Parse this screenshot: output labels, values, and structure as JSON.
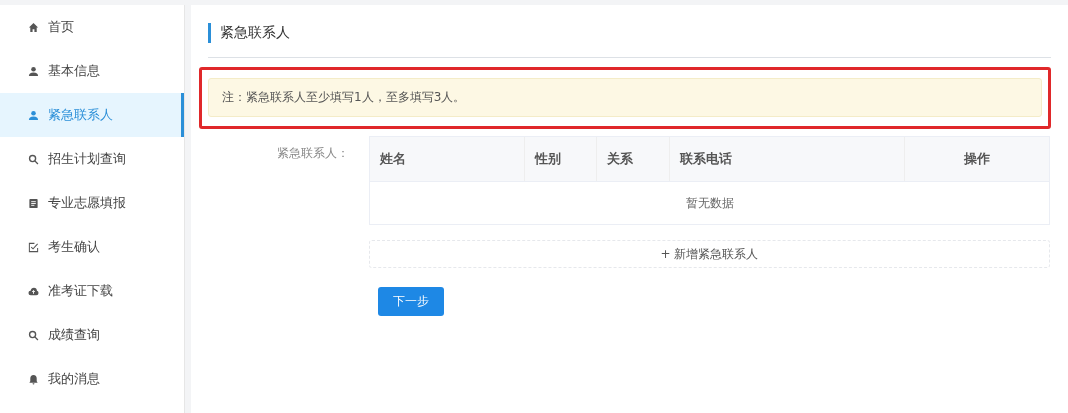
{
  "sidebar": {
    "items": [
      {
        "label": "首页",
        "selected": false
      },
      {
        "label": "基本信息",
        "selected": false
      },
      {
        "label": "紧急联系人",
        "selected": true
      },
      {
        "label": "招生计划查询",
        "selected": false
      },
      {
        "label": "专业志愿填报",
        "selected": false
      },
      {
        "label": "考生确认",
        "selected": false
      },
      {
        "label": "准考证下载",
        "selected": false
      },
      {
        "label": "成绩查询",
        "selected": false
      },
      {
        "label": "我的消息",
        "selected": false
      }
    ]
  },
  "section_title": "紧急联系人",
  "notice": "注：紧急联系人至少填写1人，至多填写3人。",
  "form": {
    "label": "紧急联系人：",
    "table": {
      "columns": [
        "姓名",
        "性别",
        "关系",
        "联系电话",
        "操作"
      ],
      "empty_text": "暂无数据"
    },
    "add_button": "+ 新增紧急联系人"
  },
  "next_button": "下一步"
}
